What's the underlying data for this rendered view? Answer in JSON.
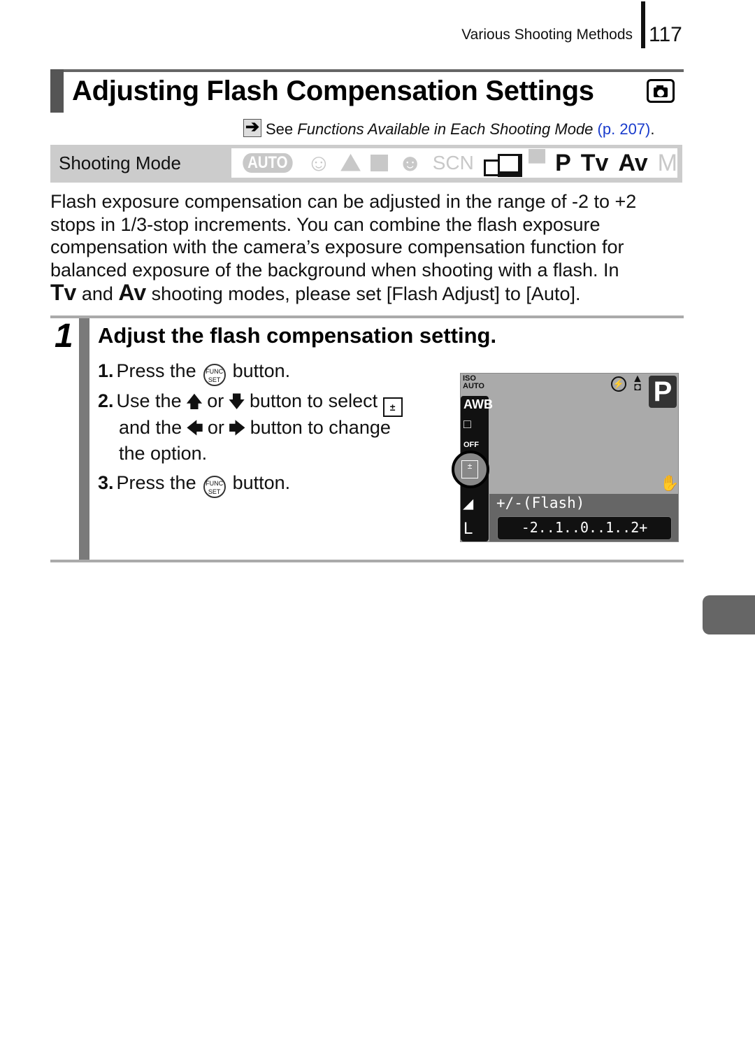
{
  "header": {
    "section": "Various Shooting Methods",
    "page_number": "117"
  },
  "title": {
    "text": "Adjusting Flash Compensation Settings",
    "mode_icon": "camera-still-icon"
  },
  "reference": {
    "prefix": "See ",
    "italic_text": "Functions Available in Each Shooting Mode",
    "link_text": "(p. 207)",
    "suffix": ".",
    "link_color": "#1a3ccc"
  },
  "shooting_mode": {
    "label": "Shooting Mode",
    "modes": [
      {
        "name": "AUTO",
        "enabled": false
      },
      {
        "name": "portrait",
        "enabled": false
      },
      {
        "name": "landscape",
        "enabled": false
      },
      {
        "name": "night-snapshot",
        "enabled": false
      },
      {
        "name": "kids-pets",
        "enabled": false
      },
      {
        "name": "SCN",
        "enabled": false
      },
      {
        "name": "stitch-assist",
        "enabled": true
      },
      {
        "name": "movie",
        "enabled": false
      },
      {
        "name": "P",
        "enabled": true
      },
      {
        "name": "Tv",
        "enabled": true
      },
      {
        "name": "Av",
        "enabled": true
      },
      {
        "name": "M",
        "enabled": false
      }
    ],
    "labels": {
      "auto": "AUTO",
      "scn": "SCN",
      "p": "P",
      "tv": "Tv",
      "av": "Av",
      "m": "M"
    }
  },
  "body": {
    "text": "Flash exposure compensation can be adjusted in the range of -2 to +2 stops in 1/3-stop increments. You can combine the flash exposure compensation with the camera’s exposure compensation function for balanced exposure of the background when shooting with a flash. In",
    "tv": "Tv",
    "and": " and ",
    "av": "Av",
    "tail": " shooting modes, please set [Flash Adjust] to [Auto]."
  },
  "step": {
    "number": "1",
    "title": "Adjust the flash compensation setting.",
    "substeps": [
      {
        "num": "1.",
        "a": "Press the",
        "b": "button."
      },
      {
        "num": "2.",
        "a": "Use the",
        "or1": "or",
        "b": "button to select",
        "c": "and the",
        "or2": "or",
        "d": "button to change",
        "e": "the option."
      },
      {
        "num": "3.",
        "a": "Press the",
        "b": "button."
      }
    ],
    "func_label_top": "FUNC.",
    "func_label_bottom": "SET"
  },
  "lcd": {
    "iso_top": "ISO",
    "iso_bottom": "AUTO",
    "side_items": [
      "AWB",
      "□",
      "OFF",
      "",
      "L"
    ],
    "mode": "P",
    "caption": "+/-(Flash)",
    "scale": "-2..1..0..1..2+",
    "current_value": 0,
    "range": [
      -2,
      2
    ]
  }
}
